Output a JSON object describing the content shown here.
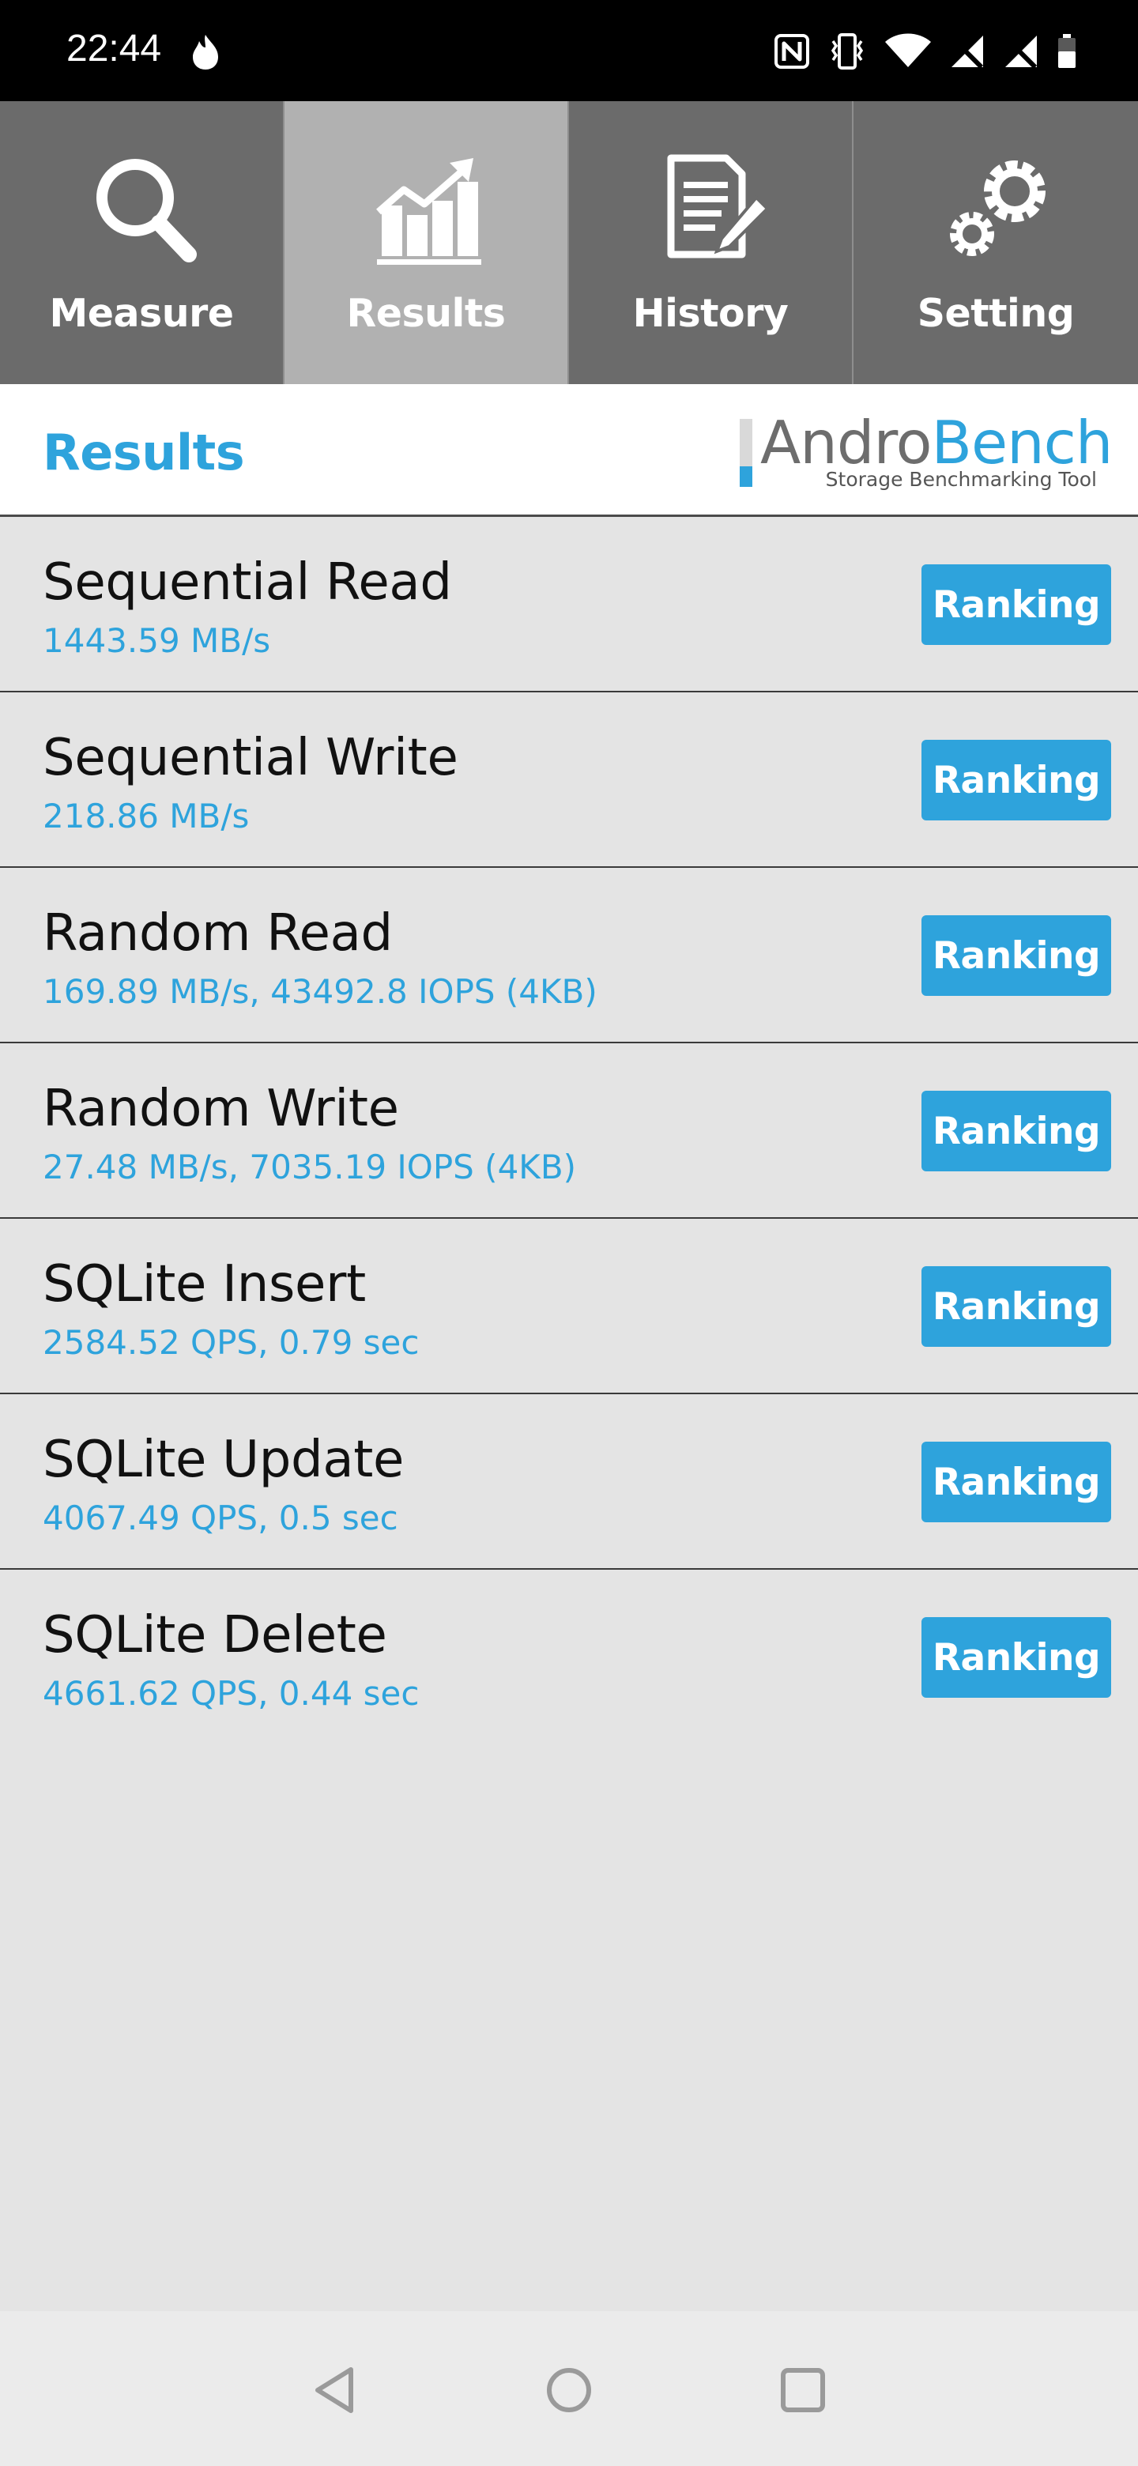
{
  "status_bar": {
    "time": "22:44",
    "left_icon": "flame-icon",
    "icons": [
      "nfc-icon",
      "vibrate-icon",
      "wifi-icon",
      "no-signal-icon",
      "no-signal-icon",
      "battery-icon"
    ]
  },
  "tabs": [
    {
      "label": "Measure",
      "icon": "magnifier-icon",
      "active": false
    },
    {
      "label": "Results",
      "icon": "bar-chart-icon",
      "active": true
    },
    {
      "label": "History",
      "icon": "document-pencil-icon",
      "active": false
    },
    {
      "label": "Setting",
      "icon": "gears-icon",
      "active": false
    }
  ],
  "header": {
    "title": "Results",
    "logo": {
      "part1": "Andro",
      "part2": "Bench",
      "subtitle": "Storage Benchmarking Tool"
    }
  },
  "results": [
    {
      "name": "Sequential Read",
      "value": "1443.59 MB/s",
      "button": "Ranking"
    },
    {
      "name": "Sequential Write",
      "value": "218.86 MB/s",
      "button": "Ranking"
    },
    {
      "name": "Random Read",
      "value": "169.89 MB/s, 43492.8 IOPS (4KB)",
      "button": "Ranking"
    },
    {
      "name": "Random Write",
      "value": "27.48 MB/s, 7035.19 IOPS (4KB)",
      "button": "Ranking"
    },
    {
      "name": "SQLite Insert",
      "value": "2584.52 QPS, 0.79 sec",
      "button": "Ranking"
    },
    {
      "name": "SQLite Update",
      "value": "4067.49 QPS, 0.5 sec",
      "button": "Ranking"
    },
    {
      "name": "SQLite Delete",
      "value": "4661.62 QPS, 0.44 sec",
      "button": "Ranking"
    }
  ],
  "colors": {
    "accent": "#2ea3dc",
    "tab_bg": "#6b6b6b",
    "tab_active_bg": "#b1b1b1",
    "list_bg": "#e4e4e4"
  },
  "nav": [
    "back-icon",
    "home-icon",
    "recents-icon"
  ]
}
